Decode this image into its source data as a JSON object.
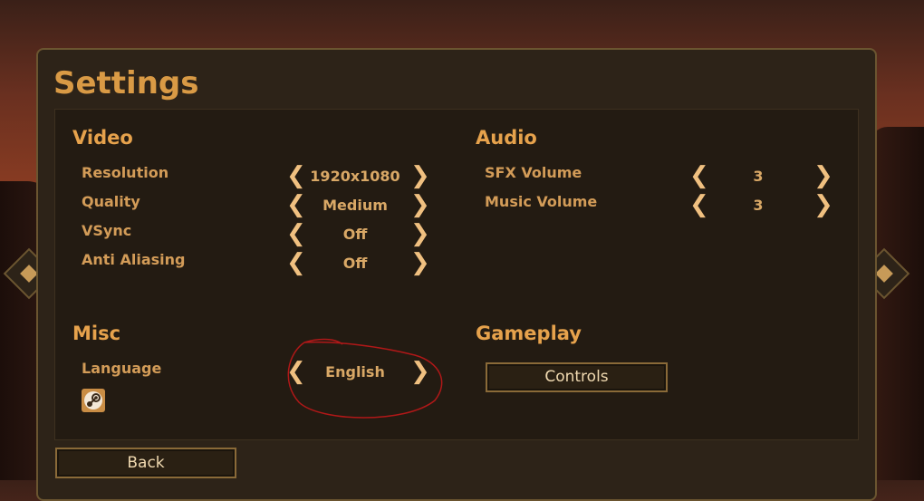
{
  "title": "Settings",
  "video": {
    "heading": "Video",
    "rows": [
      {
        "label": "Resolution",
        "value": "1920x1080"
      },
      {
        "label": "Quality",
        "value": "Medium"
      },
      {
        "label": "VSync",
        "value": "Off"
      },
      {
        "label": "Anti Aliasing",
        "value": "Off"
      }
    ]
  },
  "audio": {
    "heading": "Audio",
    "rows": [
      {
        "label": "SFX Volume",
        "value": "3"
      },
      {
        "label": "Music Volume",
        "value": "3"
      }
    ]
  },
  "misc": {
    "heading": "Misc",
    "language_label": "Language",
    "language_value": "English"
  },
  "gameplay": {
    "heading": "Gameplay",
    "controls_label": "Controls"
  },
  "back_label": "Back",
  "arrows": {
    "left": "❮",
    "right": "❯"
  },
  "colors": {
    "accent": "#e6a24c",
    "panel": "#2d2318",
    "annotation": "#b01818"
  }
}
